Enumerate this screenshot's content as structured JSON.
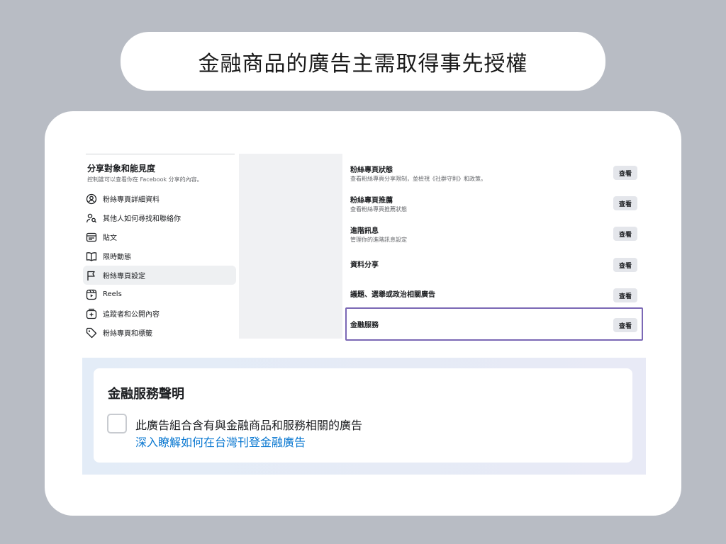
{
  "heading": "金融商品的廣告主需取得事先授權",
  "menu": {
    "title": "分享對象和能見度",
    "subtitle": "控制誰可以查看你在 Facebook 分享的內容。",
    "items": [
      {
        "label": "粉絲專頁詳細資料",
        "icon": "person-circle-icon"
      },
      {
        "label": "其他人如何尋找和聯絡你",
        "icon": "person-search-icon"
      },
      {
        "label": "貼文",
        "icon": "post-icon"
      },
      {
        "label": "限時動態",
        "icon": "book-icon"
      },
      {
        "label": "粉絲專頁設定",
        "icon": "flag-icon",
        "active": true
      },
      {
        "label": "Reels",
        "icon": "reels-icon"
      },
      {
        "label": "追蹤者和公開內容",
        "icon": "followers-icon"
      },
      {
        "label": "粉絲專頁和標籤",
        "icon": "tag-icon"
      }
    ]
  },
  "settings": [
    {
      "label": "粉絲專頁狀態",
      "desc": "查看粉絲專頁分享限制，並檢視《社群守則》和政策。",
      "button": "查看"
    },
    {
      "label": "粉絲專頁推薦",
      "desc": "查看粉絲專頁推薦狀態",
      "button": "查看"
    },
    {
      "label": "進階訊息",
      "desc": "管理你的進階訊息設定",
      "button": "查看"
    },
    {
      "label": "資料分享",
      "desc": "",
      "button": "查看"
    },
    {
      "label": "議題、選舉或政治相關廣告",
      "desc": "",
      "button": "查看"
    },
    {
      "label": "金融服務",
      "desc": "",
      "button": "查看"
    }
  ],
  "financial": {
    "title": "金融服務聲明",
    "checkbox_label": "此廣告組合含有與金融商品和服務相關的廣告",
    "link": "深入瞭解如何在台灣刊登金融廣告"
  },
  "colors": {
    "accent": "#7b68b5",
    "link": "#0a78d1",
    "background": "#b8bcc4"
  }
}
